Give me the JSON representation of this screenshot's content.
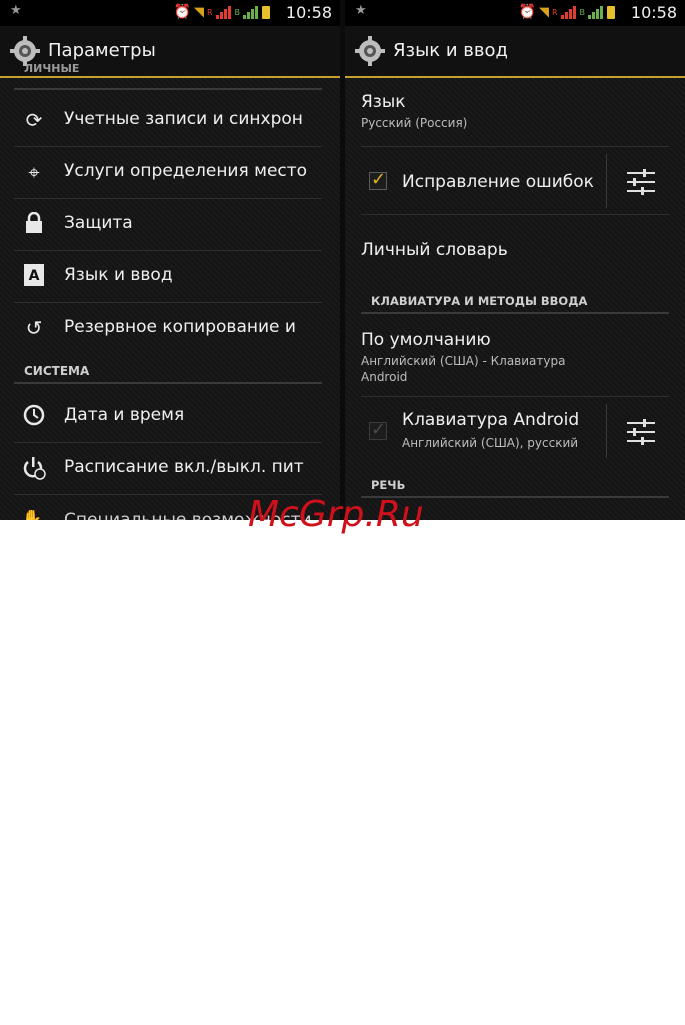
{
  "status": {
    "time": "10:58"
  },
  "left": {
    "title": "Параметры",
    "section_personal": "ЛИЧНЫЕ",
    "items": [
      {
        "icon": "sync-icon",
        "label": "Учетные записи и синхрон"
      },
      {
        "icon": "location-icon",
        "label": "Услуги определения место"
      },
      {
        "icon": "lock-icon",
        "label": "Защита"
      },
      {
        "icon": "language-icon",
        "label": "Язык и ввод"
      },
      {
        "icon": "backup-icon",
        "label": "Резервное копирование и"
      }
    ],
    "section_system": "СИСТЕМА",
    "system_items": [
      {
        "icon": "clock-icon",
        "label": "Дата и время"
      },
      {
        "icon": "power-schedule-icon",
        "label": "Расписание вкл./выкл. пит"
      },
      {
        "icon": "hand-icon",
        "label": "Специальные возможности"
      }
    ]
  },
  "right": {
    "title": "Язык и ввод",
    "language": {
      "title": "Язык",
      "value": "Русский (Россия)"
    },
    "spellcheck": {
      "label": "Исправление ошибок",
      "checked": true
    },
    "dictionary": "Личный словарь",
    "section_keyboard": "КЛАВИАТУРА И МЕТОДЫ ВВОДА",
    "default": {
      "title": "По умолчанию",
      "value_line1": "Английский (США) - Клавиатура",
      "value_line2": "Android"
    },
    "keyboard": {
      "title": "Клавиатура Android",
      "value": "Английский (США), русский",
      "checked": false
    },
    "section_speech": "РЕЧЬ"
  },
  "watermark": "McGrp.Ru",
  "colors": {
    "accent": "#c8a032",
    "watermark": "#d0101a"
  }
}
